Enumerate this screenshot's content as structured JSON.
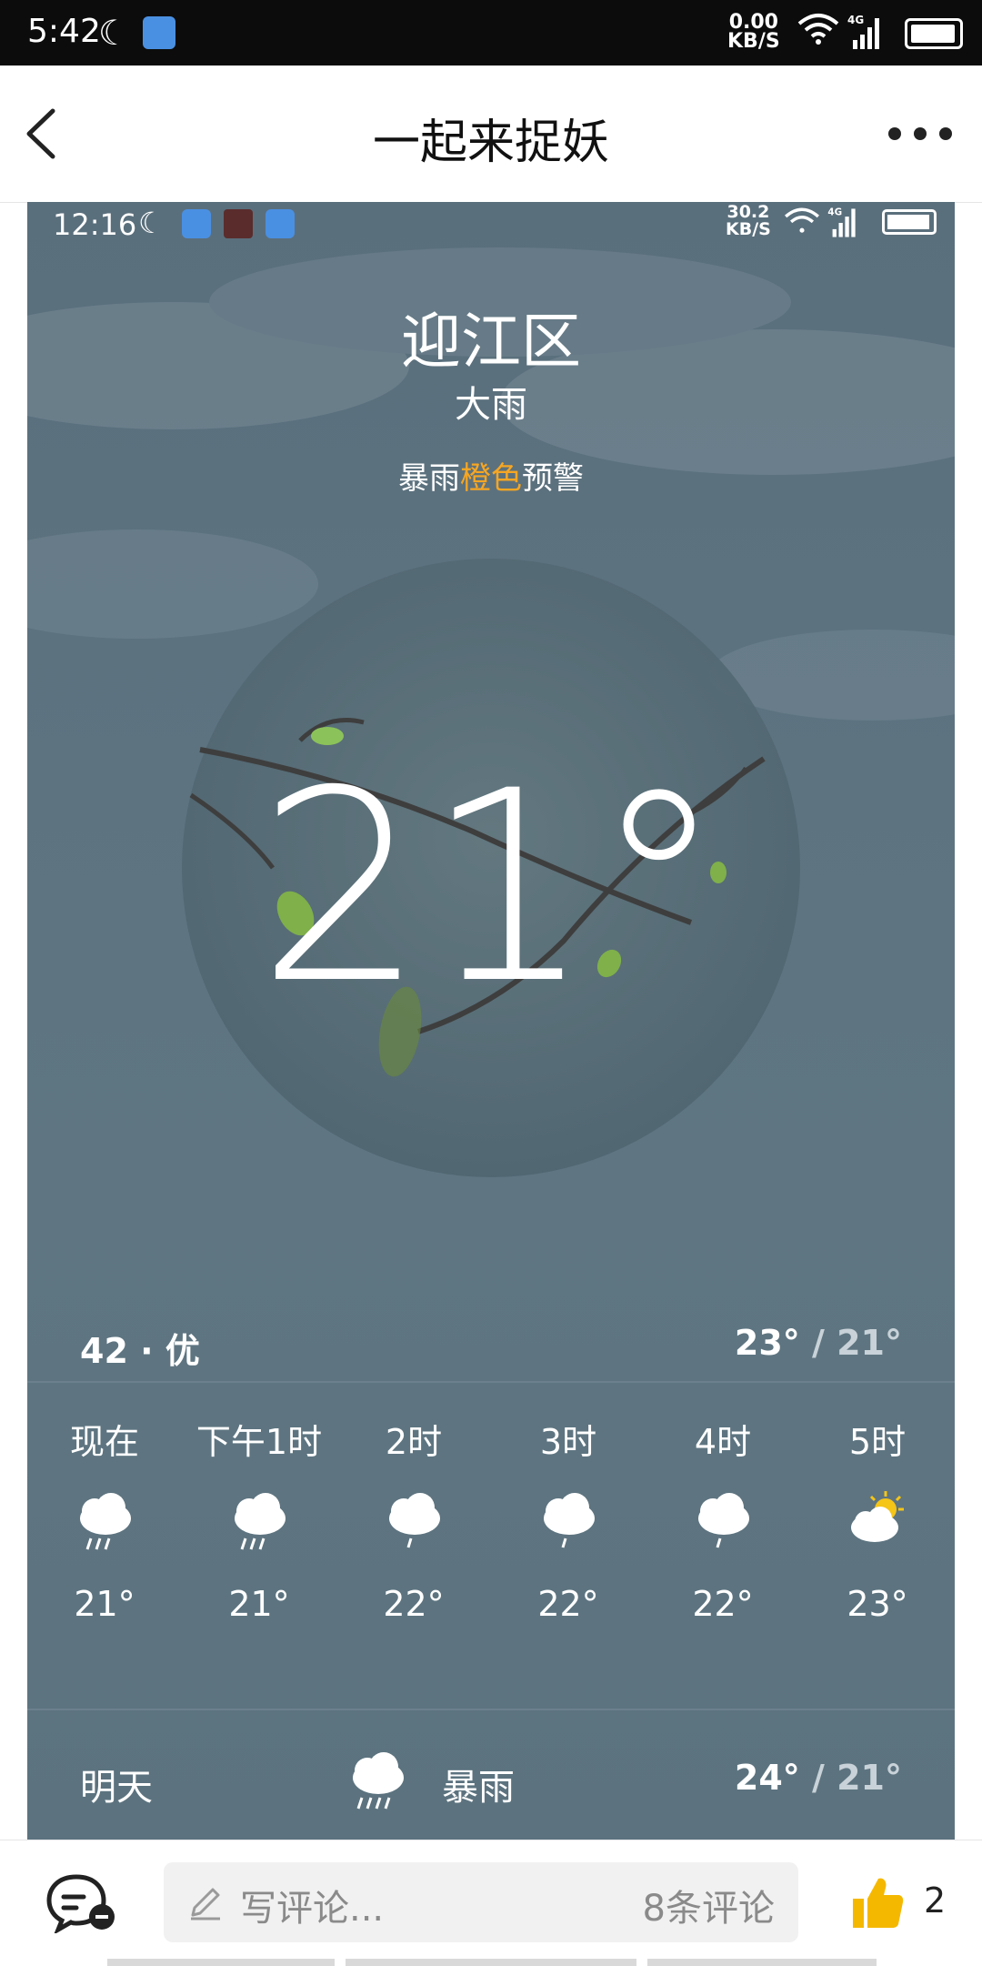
{
  "status_bar": {
    "time": "5:42",
    "net_speed": "0.00",
    "net_unit": "KB/S",
    "network": "4G"
  },
  "header": {
    "title": "一起来捉妖"
  },
  "weather": {
    "inner_status": {
      "time": "12:16",
      "net_speed": "30.2",
      "net_unit": "KB/S",
      "network": "4G"
    },
    "city": "迎江区",
    "condition": "大雨",
    "alert": {
      "prefix": "暴雨",
      "level": "橙色",
      "suffix": "预警",
      "level_color": "#f6a623"
    },
    "temperature": "21°",
    "aqi": "42 · 优",
    "high": "23°",
    "sep": " / ",
    "low": "21°",
    "hourly": [
      {
        "label": "现在",
        "icon": "rain-cloud-icon",
        "temp": "21°"
      },
      {
        "label": "下午1时",
        "icon": "rain-cloud-icon",
        "temp": "21°"
      },
      {
        "label": "2时",
        "icon": "drizzle-cloud-icon",
        "temp": "22°"
      },
      {
        "label": "3时",
        "icon": "drizzle-cloud-icon",
        "temp": "22°"
      },
      {
        "label": "4时",
        "icon": "drizzle-cloud-icon",
        "temp": "22°"
      },
      {
        "label": "5时",
        "icon": "partly-sunny-icon",
        "temp": "23°"
      }
    ],
    "tomorrow": {
      "day": "明天",
      "icon": "rain-cloud-icon",
      "desc": "暴雨",
      "high": "24°",
      "sep": " / ",
      "low": "21°"
    }
  },
  "bottom_bar": {
    "comment_placeholder": "写评论...",
    "comment_count": "8条评论",
    "likes": "2",
    "like_color": "#f5b800"
  }
}
